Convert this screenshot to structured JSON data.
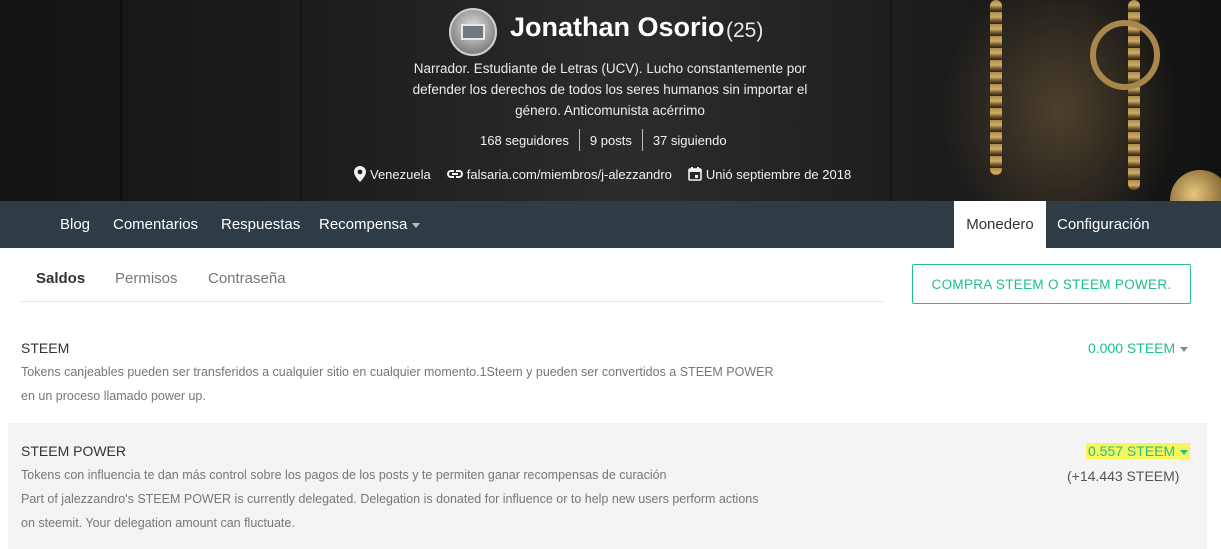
{
  "profile": {
    "name": "Jonathan Osorio",
    "reputation": "(25)",
    "bio": "Narrador. Estudiante de Letras (UCV). Lucho constantemente por defender los derechos de todos los seres humanos sin importar el género. Anticomunista acérrimo",
    "stats": {
      "followers": "168 seguidores",
      "posts": "9 posts",
      "following": "37 siguiendo"
    },
    "location": "Venezuela",
    "website": "falsaria.com/miembros/j-alezzandro",
    "joined": "Unió septiembre de 2018"
  },
  "nav": {
    "items": [
      "Blog",
      "Comentarios",
      "Respuestas",
      "Recompensa"
    ],
    "wallet": "Monedero",
    "settings": "Configuración"
  },
  "wallet_tabs": [
    "Saldos",
    "Permisos",
    "Contraseña"
  ],
  "buy_button": "COMPRA STEEM O STEEM POWER.",
  "steem": {
    "title": "STEEM",
    "description": "Tokens canjeables pueden ser transferidos a cualquier sitio en cualquier momento.1Steem y pueden ser convertidos a STEEM POWER en un proceso llamado power up.",
    "amount": "0.000 STEEM"
  },
  "steem_power": {
    "title": "STEEM POWER",
    "description1": "Tokens con influencia te dan más control sobre los pagos de los posts y te permiten ganar recompensas de curación",
    "description2": "Part of jalezzandro's STEEM POWER is currently delegated. Delegation is donated for influence or to help new users perform actions on steemit. Your delegation amount can fluctuate.",
    "amount": "0.557 STEEM",
    "delegated": "(+14.443 STEEM)"
  },
  "colors": {
    "accent": "#1fbf8f",
    "nav_bg": "#2f3c46",
    "highlight": "#f8f55b"
  }
}
